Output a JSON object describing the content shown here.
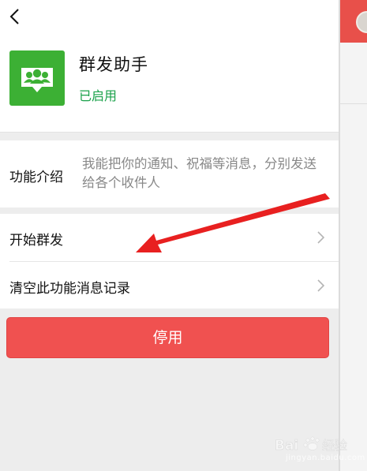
{
  "header": {
    "back_icon": "chevron-left-icon",
    "app_name": "群发助手",
    "app_status": "已启用",
    "app_icon": "group-chat-icon",
    "status_color": "#1aa14a",
    "icon_color": "#3cb034"
  },
  "intro": {
    "label": "功能介绍",
    "text": "我能把你的通知、祝福等消息，分别发送给各个收件人"
  },
  "list": {
    "items": [
      {
        "label": "开始群发",
        "icon": "chevron-right-icon"
      },
      {
        "label": "清空此功能消息记录",
        "icon": "chevron-right-icon"
      }
    ]
  },
  "actions": {
    "disable_label": "停用",
    "disable_color": "#f05150"
  },
  "annotation": {
    "arrow_color": "#e82020",
    "arrow_icon": "red-arrow-annotation"
  },
  "watermark": {
    "logo": "Bai 经验",
    "url": "jingyan.baidu.com"
  }
}
